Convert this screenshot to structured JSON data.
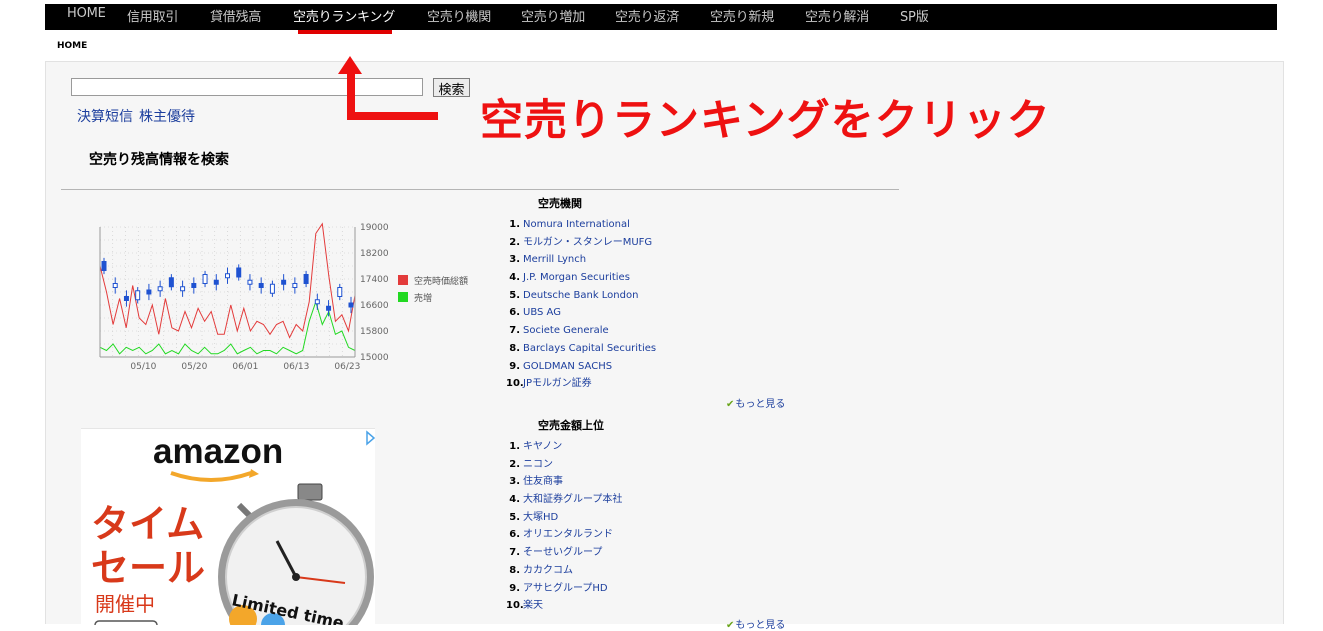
{
  "nav": {
    "items": [
      {
        "label": "HOME"
      },
      {
        "label": "信用取引"
      },
      {
        "label": "貸借残高"
      },
      {
        "label": "空売りランキング"
      },
      {
        "label": "空売り機関"
      },
      {
        "label": "空売り増加"
      },
      {
        "label": "空売り返済"
      },
      {
        "label": "空売り新規"
      },
      {
        "label": "空売り解消"
      },
      {
        "label": "SP版"
      }
    ],
    "active_index": 3
  },
  "breadcrumb": "HOME",
  "search": {
    "value": "",
    "button_label": "検索"
  },
  "quick_links": [
    "決算短信",
    "株主優待"
  ],
  "annotation_text": "空売りランキングをクリック",
  "section_title": "空売り残高情報を検索",
  "chart_data": {
    "type": "line",
    "x_tick_labels": [
      "05/10",
      "05/20",
      "06/01",
      "06/13",
      "06/23"
    ],
    "y_tick_labels": [
      "19000",
      "18200",
      "17400",
      "16600",
      "15800",
      "15000"
    ],
    "ylim": [
      15000,
      19000
    ],
    "grid": true,
    "legend_position": "right",
    "series": [
      {
        "name": "空売時価総額",
        "color": "#e33b3b",
        "values": [
          17800,
          17000,
          16000,
          16800,
          15900,
          17200,
          16200,
          16000,
          16600,
          15700,
          16800,
          15900,
          15800,
          16400,
          15900,
          16500,
          16100,
          16400,
          15700,
          15700,
          16600,
          15800,
          16500,
          15800,
          16100,
          16000,
          15700,
          16000,
          16100,
          15600,
          16000,
          15800,
          16700,
          18800,
          19100,
          17500,
          16100,
          16300,
          15800,
          16900
        ]
      },
      {
        "name": "売増",
        "color": "#22d922",
        "values": [
          15300,
          15200,
          15400,
          15100,
          15300,
          15200,
          15300,
          15100,
          15200,
          15400,
          15100,
          15200,
          15100,
          15400,
          15200,
          15100,
          15300,
          15100,
          15100,
          15200,
          15400,
          15100,
          15200,
          15300,
          15100,
          15200,
          15200,
          15100,
          15300,
          15200,
          15100,
          15200,
          16100,
          16700,
          16000,
          16400,
          15700,
          15800,
          15300,
          15200
        ]
      }
    ],
    "candles_color": "#1f52d1"
  },
  "institutions": {
    "heading": "空売機関",
    "items": [
      "Nomura International",
      "モルガン・スタンレーMUFG",
      "Merrill Lynch",
      "J.P. Morgan Securities",
      "Deutsche Bank London",
      "UBS AG",
      "Societe Generale",
      "Barclays Capital Securities",
      "GOLDMAN SACHS",
      "JPモルガン証券"
    ],
    "more_label": "もっと見る"
  },
  "top_amount": {
    "heading": "空売金額上位",
    "items": [
      "キヤノン",
      "ニコン",
      "住友商事",
      "大和証券グループ本社",
      "大塚HD",
      "オリエンタルランド",
      "そーせいグループ",
      "カカクコム",
      "アサヒグループHD",
      "楽天"
    ],
    "more_label": "もっと見る"
  },
  "ad": {
    "brand": "amazon",
    "headline_line1": "タイム",
    "headline_line2": "セール",
    "subline": "開催中",
    "badge": "Limited time",
    "brand_color": "#111111",
    "headline_color": "#d8391a",
    "accent_color": "#f3a72a"
  }
}
